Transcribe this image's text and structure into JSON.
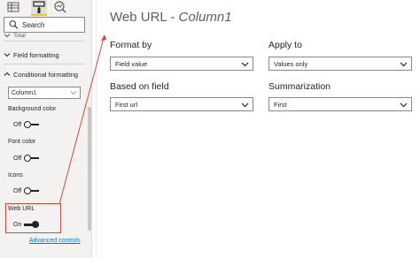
{
  "pane": {
    "tabs": [
      {
        "name": "fields"
      },
      {
        "name": "format",
        "selected": true
      },
      {
        "name": "analytics"
      }
    ],
    "search": {
      "placeholder": "Search"
    },
    "cut_off_row": "Total",
    "sections": {
      "field_formatting": "Field formatting",
      "conditional_formatting": "Conditional formatting"
    },
    "column_select": {
      "value": "Column1"
    },
    "properties": [
      {
        "label": "Background color",
        "toggle": "Off"
      },
      {
        "label": "Font color",
        "toggle": "Off"
      },
      {
        "label": "Icons",
        "toggle": "Off"
      },
      {
        "label": "Web URL",
        "toggle": "On"
      }
    ],
    "advanced_link": "Advanced controls"
  },
  "main": {
    "title": "Web URL - ",
    "title_italic": "Column1",
    "format_by": {
      "label": "Format by",
      "value": "Field value"
    },
    "apply_to": {
      "label": "Apply to",
      "value": "Values only"
    },
    "based_on_field": {
      "label": "Based on field",
      "value": "First url"
    },
    "summarization": {
      "label": "Summarization",
      "value": "First"
    }
  },
  "colors": {
    "pane_background": "#f3f2f1",
    "selected_tab_accent": "#f2c811",
    "link": "#0078d4",
    "annotation": "#e0443c"
  }
}
